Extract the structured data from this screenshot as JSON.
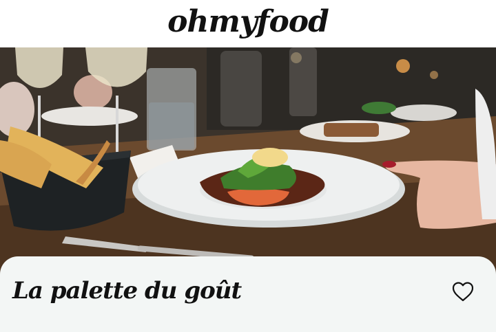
{
  "header": {
    "brand": "ohmyfood"
  },
  "hero": {
    "image_description_icon": "restaurant-dish-photo"
  },
  "card": {
    "restaurant_name": "La palette du goût",
    "favorite_icon": "heart-outline-icon"
  },
  "colors": {
    "text": "#111111",
    "card_background": "#f3f6f5",
    "page_background": "#ffffff"
  }
}
